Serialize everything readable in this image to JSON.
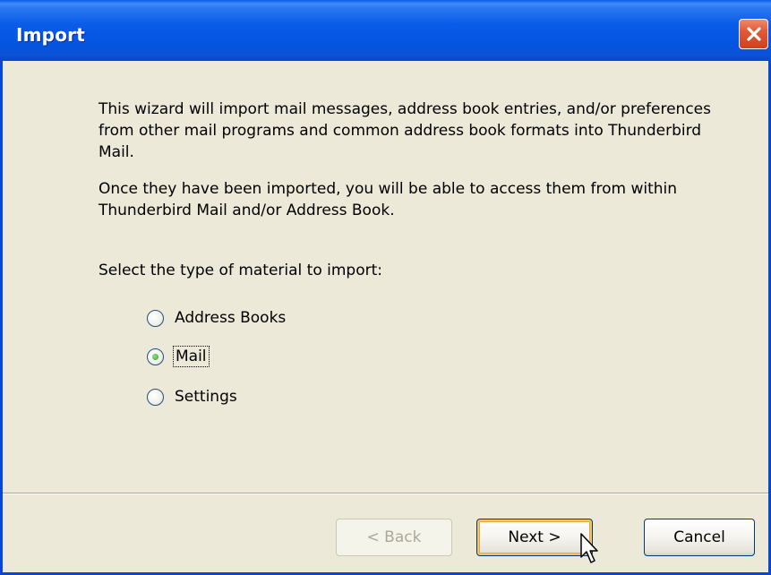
{
  "window": {
    "title": "Import"
  },
  "content": {
    "paragraph1": "This wizard will import mail messages, address book entries, and/or preferences from other mail programs and common address book formats into Thunderbird Mail.",
    "paragraph2": "Once they have been imported, you will be able to access them from within Thunderbird Mail and/or Address Book.",
    "prompt": "Select the type of material to import:"
  },
  "options": [
    {
      "label": "Address Books",
      "checked": false
    },
    {
      "label": "Mail",
      "checked": true
    },
    {
      "label": "Settings",
      "checked": false
    }
  ],
  "buttons": {
    "back": "< Back",
    "next": "Next >",
    "cancel": "Cancel"
  },
  "icons": {
    "close": "close-icon",
    "cursor": "mouse-pointer-icon"
  },
  "colors": {
    "titlebar": "#0A5CE8",
    "dialog_background": "#ECE9D8",
    "close_button": "#E2593A",
    "radio_checked": "#2FA32A"
  }
}
